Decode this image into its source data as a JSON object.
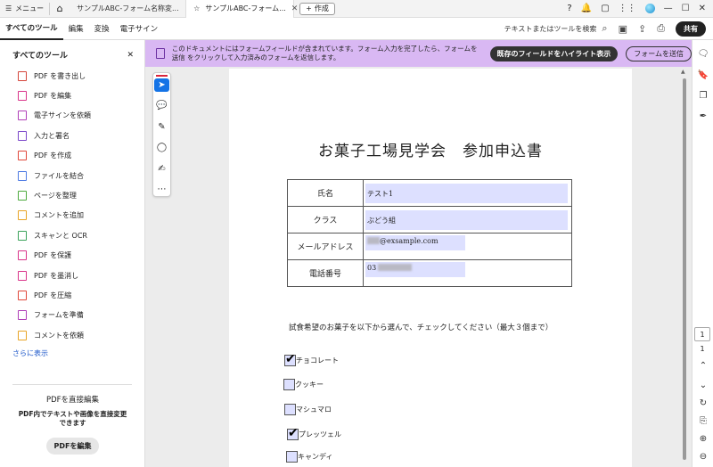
{
  "titlebar": {
    "menu_label": "メニュー",
    "tabs": [
      {
        "label": "サンプルABC-フォーム名称変..."
      },
      {
        "label": "サンプルABC-フォーム..."
      }
    ],
    "new_tab_label": "作成"
  },
  "toolbar": {
    "tabs": [
      "すべてのツール",
      "編集",
      "変換",
      "電子サイン"
    ],
    "search_label": "テキストまたはツールを検索",
    "share_label": "共有"
  },
  "left_panel": {
    "title": "すべてのツール",
    "items": [
      {
        "label": "PDF を書き出し",
        "color": "#d4453b"
      },
      {
        "label": "PDF を編集",
        "color": "#d9348a"
      },
      {
        "label": "電子サインを依頼",
        "color": "#b03fb8"
      },
      {
        "label": "入力と署名",
        "color": "#7b47c9"
      },
      {
        "label": "PDF を作成",
        "color": "#e0473a"
      },
      {
        "label": "ファイルを結合",
        "color": "#4f7be3"
      },
      {
        "label": "ページを整理",
        "color": "#4caa3d"
      },
      {
        "label": "コメントを追加",
        "color": "#e8a425"
      },
      {
        "label": "スキャンと OCR",
        "color": "#3aa25a"
      },
      {
        "label": "PDF を保護",
        "color": "#d9348a"
      },
      {
        "label": "PDF を墨消し",
        "color": "#d9348a"
      },
      {
        "label": "PDF を圧縮",
        "color": "#e0473a"
      },
      {
        "label": "フォームを準備",
        "color": "#b03fb8"
      },
      {
        "label": "コメントを依頼",
        "color": "#e8a425"
      }
    ],
    "more_link": "さらに表示",
    "promo": {
      "title": "PDFを直接編集",
      "description": "PDF内でテキストや画像を直接変更できます",
      "button": "PDFを編集"
    }
  },
  "banner": {
    "text": "このドキュメントにはフォームフィールドが含まれています。フォーム入力を完了したら、フォームを送信 をクリックして入力済みのフォームを返信します。",
    "highlight_button": "既存のフィールドをハイライト表示",
    "send_button": "フォームを送信"
  },
  "document": {
    "title": "お菓子工場見学会　参加申込書",
    "fields": [
      {
        "label": "氏名",
        "value": "テスト1"
      },
      {
        "label": "クラス",
        "value": "ぶどう組"
      },
      {
        "label": "メールアドレス",
        "value": "@exsample.com"
      },
      {
        "label": "電話番号",
        "value": "03"
      }
    ],
    "instruction": "試食希望のお菓子を以下から選んで、チェックしてください（最大３個まで）",
    "checkboxes": [
      {
        "label": "チョコレート",
        "checked": true
      },
      {
        "label": "クッキー",
        "checked": false
      },
      {
        "label": "マシュマロ",
        "checked": false
      },
      {
        "label": "プレッツェル",
        "checked": true
      },
      {
        "label": "キャンディ",
        "checked": false
      }
    ]
  },
  "page_nav": {
    "current": "1",
    "total": "1"
  }
}
